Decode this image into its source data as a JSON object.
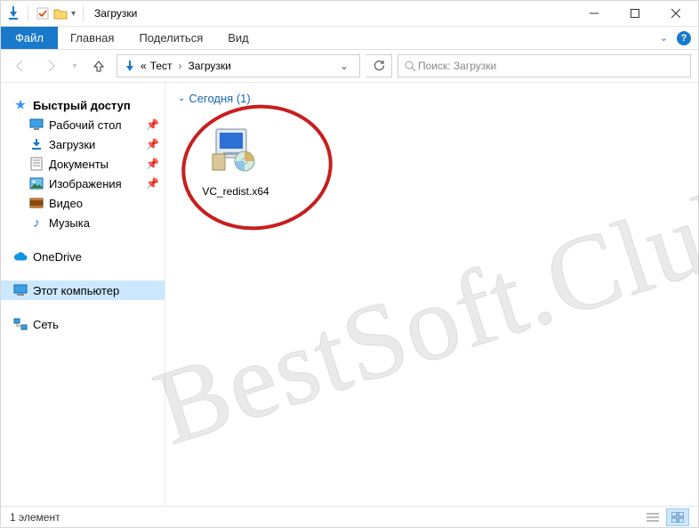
{
  "window": {
    "title": "Загрузки"
  },
  "ribbon": {
    "file": "Файл",
    "home": "Главная",
    "share": "Поделиться",
    "view": "Вид"
  },
  "address": {
    "prefix": "«",
    "crumb1": "Тест",
    "crumb2": "Загрузки"
  },
  "search": {
    "placeholder": "Поиск: Загрузки"
  },
  "nav": {
    "quick_access": "Быстрый доступ",
    "desktop": "Рабочий стол",
    "downloads": "Загрузки",
    "documents": "Документы",
    "pictures": "Изображения",
    "videos": "Видео",
    "music": "Музыка",
    "onedrive": "OneDrive",
    "this_pc": "Этот компьютер",
    "network": "Сеть"
  },
  "content": {
    "group_header": "Сегодня (1)",
    "file_label": "VC_redist.x64"
  },
  "status": {
    "count": "1 элемент"
  },
  "watermark": "BestSoft.Club"
}
